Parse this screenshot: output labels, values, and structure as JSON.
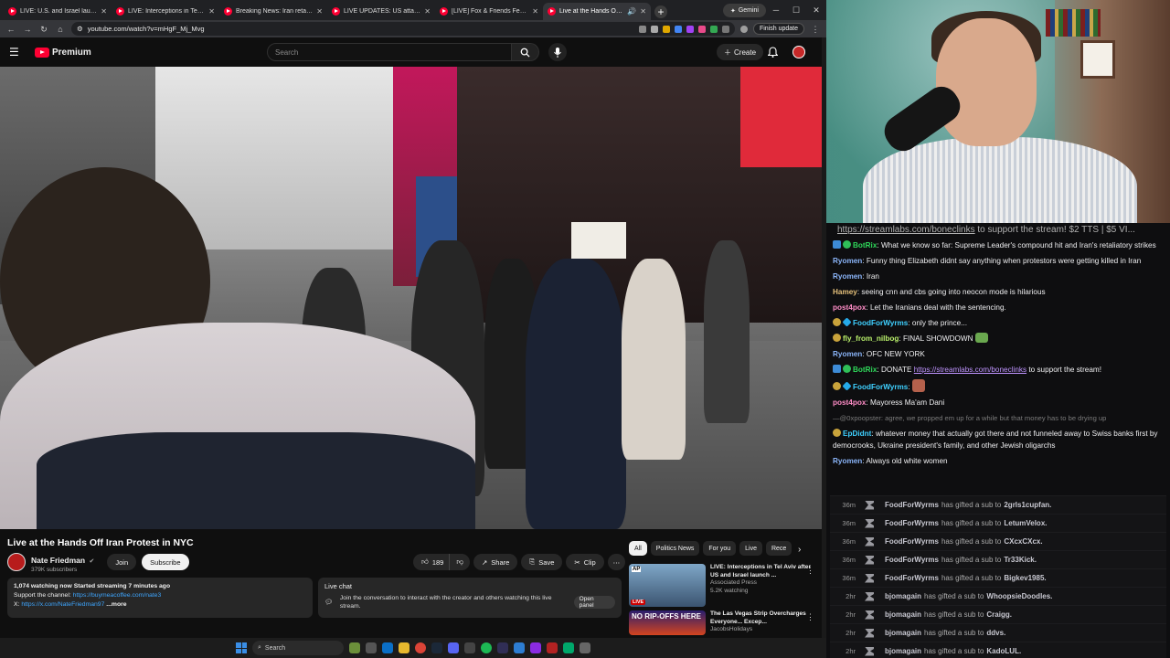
{
  "browser": {
    "tabs": [
      {
        "label": "LIVE: U.S. and Israel launch joi"
      },
      {
        "label": "LIVE: Interceptions in Tel Aviv a"
      },
      {
        "label": "Breaking News: Iran retaliates a"
      },
      {
        "label": "LIVE UPDATES: US attacks Iran"
      },
      {
        "label": "[LIVE] Fox & Friends Feb 28, 20"
      },
      {
        "label": "Live at the Hands Off Iran P"
      }
    ],
    "gemini_label": "Gemini",
    "url": "youtube.com/watch?v=mHgF_Mj_Mvg",
    "finish_update_label": "Finish update"
  },
  "youtube": {
    "logo_text": "Premium",
    "search_placeholder": "Search",
    "create_label": "Create",
    "video_title": "Live at the Hands Off Iran Protest in NYC",
    "channel_name": "Nate Friedman",
    "subscribers": "379K subscribers",
    "join_label": "Join",
    "subscribe_label": "Subscribe",
    "like_count": "189",
    "share_label": "Share",
    "save_label": "Save",
    "clip_label": "Clip",
    "description": {
      "stats": "1,074 watching now  Started streaming 7 minutes ago",
      "support_prefix": "Support the channel: ",
      "support_link": "https://buymeacoffee.com/nate3",
      "x_prefix": "X: ",
      "x_link": "https://x.com/NateFriedman97",
      "more": " ...more"
    },
    "live_chat": {
      "title": "Live chat",
      "message": "Join the conversation to interact with the creator and others watching this live stream.",
      "open_panel_label": "Open panel"
    },
    "chips": [
      "All",
      "Politics News",
      "For you",
      "Live",
      "Rece"
    ],
    "related": [
      {
        "title": "LIVE: Interceptions in Tel Aviv after US and Israel launch ...",
        "channel": "Associated Press",
        "meta": "5.2K watching",
        "badge": "LIVE",
        "thumb_text": "AP"
      },
      {
        "title": "The Las Vegas Strip Overcharges Everyone... Excep...",
        "channel": "JacobsHolidays",
        "meta": "",
        "thumb_text": "NO RIP-OFFS HERE"
      }
    ]
  },
  "stream_chat": {
    "ticker_link": "https://streamlabs.com/boneclinks",
    "ticker_rest": " to support the stream! $2 TTS | $5 VI...",
    "messages": [
      {
        "user": "BotRix",
        "color": "#2fd85a",
        "text": "What we know so far: Supreme Leader's compound hit and Iran's retaliatory strikes",
        "badges": [
          "bx",
          "bg"
        ]
      },
      {
        "user": "Ryomen",
        "color": "#8ab4f8",
        "text": "Funny thing Elizabeth didnt say anything when protestors were getting killed in Iran",
        "badges": []
      },
      {
        "user": "Ryomen",
        "color": "#8ab4f8",
        "text": "Iran",
        "badges": []
      },
      {
        "user": "Hamey",
        "color": "#e5c07b",
        "text": "seeing cnn and cbs going into neocon mode is hilarious",
        "badges": []
      },
      {
        "user": "post4pox",
        "color": "#ff8dc7",
        "text": "Let the Iranians deal with the sentencing.",
        "badges": []
      },
      {
        "user": "FoodForWyrms",
        "color": "#3fd0ff",
        "text": "only the prince...",
        "badges": [
          "bm",
          "bc"
        ]
      },
      {
        "user": "fly_from_nilbog",
        "color": "#b9f06b",
        "text": "FINAL SHOWDOWN",
        "badges": [
          "bm"
        ],
        "emote": true
      },
      {
        "user": "Ryomen",
        "color": "#8ab4f8",
        "text": "OFC NEW YORK",
        "badges": []
      },
      {
        "user": "BotRix",
        "color": "#2fd85a",
        "text_prefix": "DONATE ",
        "link": "https://streamlabs.com/boneclinks",
        "text": " to support the stream!",
        "badges": [
          "bx",
          "bg"
        ]
      },
      {
        "user": "FoodForWyrms",
        "color": "#3fd0ff",
        "text": "",
        "badges": [
          "bm",
          "bc"
        ],
        "emote2": true
      },
      {
        "user": "post4pox",
        "color": "#ff8dc7",
        "text": "Mayoress Ma'am Dani",
        "badges": []
      },
      {
        "deleted": true,
        "text": "—@0xpoopster: agree, we propped em up for a while but that money has to be drying up"
      },
      {
        "user": "EpDidnt",
        "color": "#3fd0ff",
        "text": "whatever money that actually got there and not funneled away to Swiss banks first by democrooks, Ukraine president's family, and other Jewish oligarchs",
        "badges": [
          "bm"
        ]
      },
      {
        "user": "Ryomen",
        "color": "#8ab4f8",
        "text": "Always old white women",
        "badges": []
      }
    ],
    "sub_gifts": [
      {
        "time": "36m",
        "gifter": "FoodForWyrms",
        "text": "has gifted a sub to",
        "recipient": "2grls1cupfan."
      },
      {
        "time": "36m",
        "gifter": "FoodForWyrms",
        "text": "has gifted a sub to",
        "recipient": "LetumVelox."
      },
      {
        "time": "36m",
        "gifter": "FoodForWyrms",
        "text": "has gifted a sub to",
        "recipient": "CXcxCXcx."
      },
      {
        "time": "36m",
        "gifter": "FoodForWyrms",
        "text": "has gifted a sub to",
        "recipient": "Tr33Kick."
      },
      {
        "time": "36m",
        "gifter": "FoodForWyrms",
        "text": "has gifted a sub to",
        "recipient": "Bigkev1985."
      },
      {
        "time": "2hr",
        "gifter": "bjomagain",
        "text": "has gifted a sub to",
        "recipient": "WhoopsieDoodles."
      },
      {
        "time": "2hr",
        "gifter": "bjomagain",
        "text": "has gifted a sub to",
        "recipient": "Craigg."
      },
      {
        "time": "2hr",
        "gifter": "bjomagain",
        "text": "has gifted a sub to",
        "recipient": "ddvs."
      },
      {
        "time": "2hr",
        "gifter": "bjomagain",
        "text": "has gifted a sub to",
        "recipient": "KadoLUL."
      }
    ]
  },
  "taskbar": {
    "search_placeholder": "Search"
  },
  "colors": {
    "youtube_red": "#ff0033",
    "background": "#0f0f0f",
    "link_blue": "#3ea6ff"
  }
}
